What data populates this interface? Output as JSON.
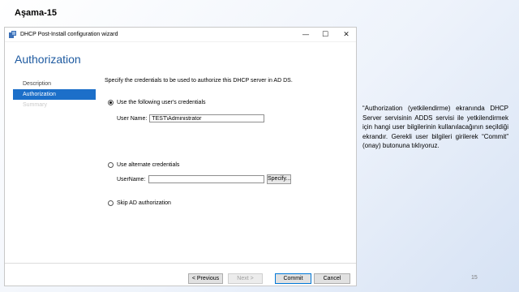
{
  "slide": {
    "title": "Aşama-15",
    "description": "“Authorization (yetkilendirme) ekranında DHCP Server servisinin ADDS servisi ile yetkilendirmek için hangi user bilgilerinin kullanılacağının seçildiği ekrandır. Gerekli user bilgileri girilerek “Commit” (onay) butonuna tıklıyoruz.",
    "page_number": "15"
  },
  "window": {
    "title": "DHCP Post-Install configuration wizard",
    "minimize_glyph": "—",
    "maximize_glyph": "☐",
    "close_glyph": "✕"
  },
  "wizard": {
    "heading": "Authorization",
    "nav": [
      {
        "label": "Description",
        "state": "normal"
      },
      {
        "label": "Authorization",
        "state": "active"
      },
      {
        "label": "Summary",
        "state": "disabled"
      }
    ],
    "instruction": "Specify the credentials to be used to authorize this DHCP server in AD DS.",
    "options": {
      "current_user": {
        "label": "Use the following user's credentials",
        "checked": true
      },
      "alternate": {
        "label": "Use alternate credentials",
        "checked": false
      },
      "skip": {
        "label": "Skip AD authorization",
        "checked": false
      }
    },
    "user_name_label": "User Name:",
    "user_name_value": "TEST\\Administrator",
    "alt_user_name_label": "UserName:",
    "alt_user_name_value": "",
    "specify_label": "Specify...",
    "buttons": {
      "previous": "< Previous",
      "next": "Next >",
      "commit": "Commit",
      "cancel": "Cancel"
    }
  },
  "colors": {
    "heading": "#1e5aa0",
    "nav_active": "#1c6fc9"
  }
}
